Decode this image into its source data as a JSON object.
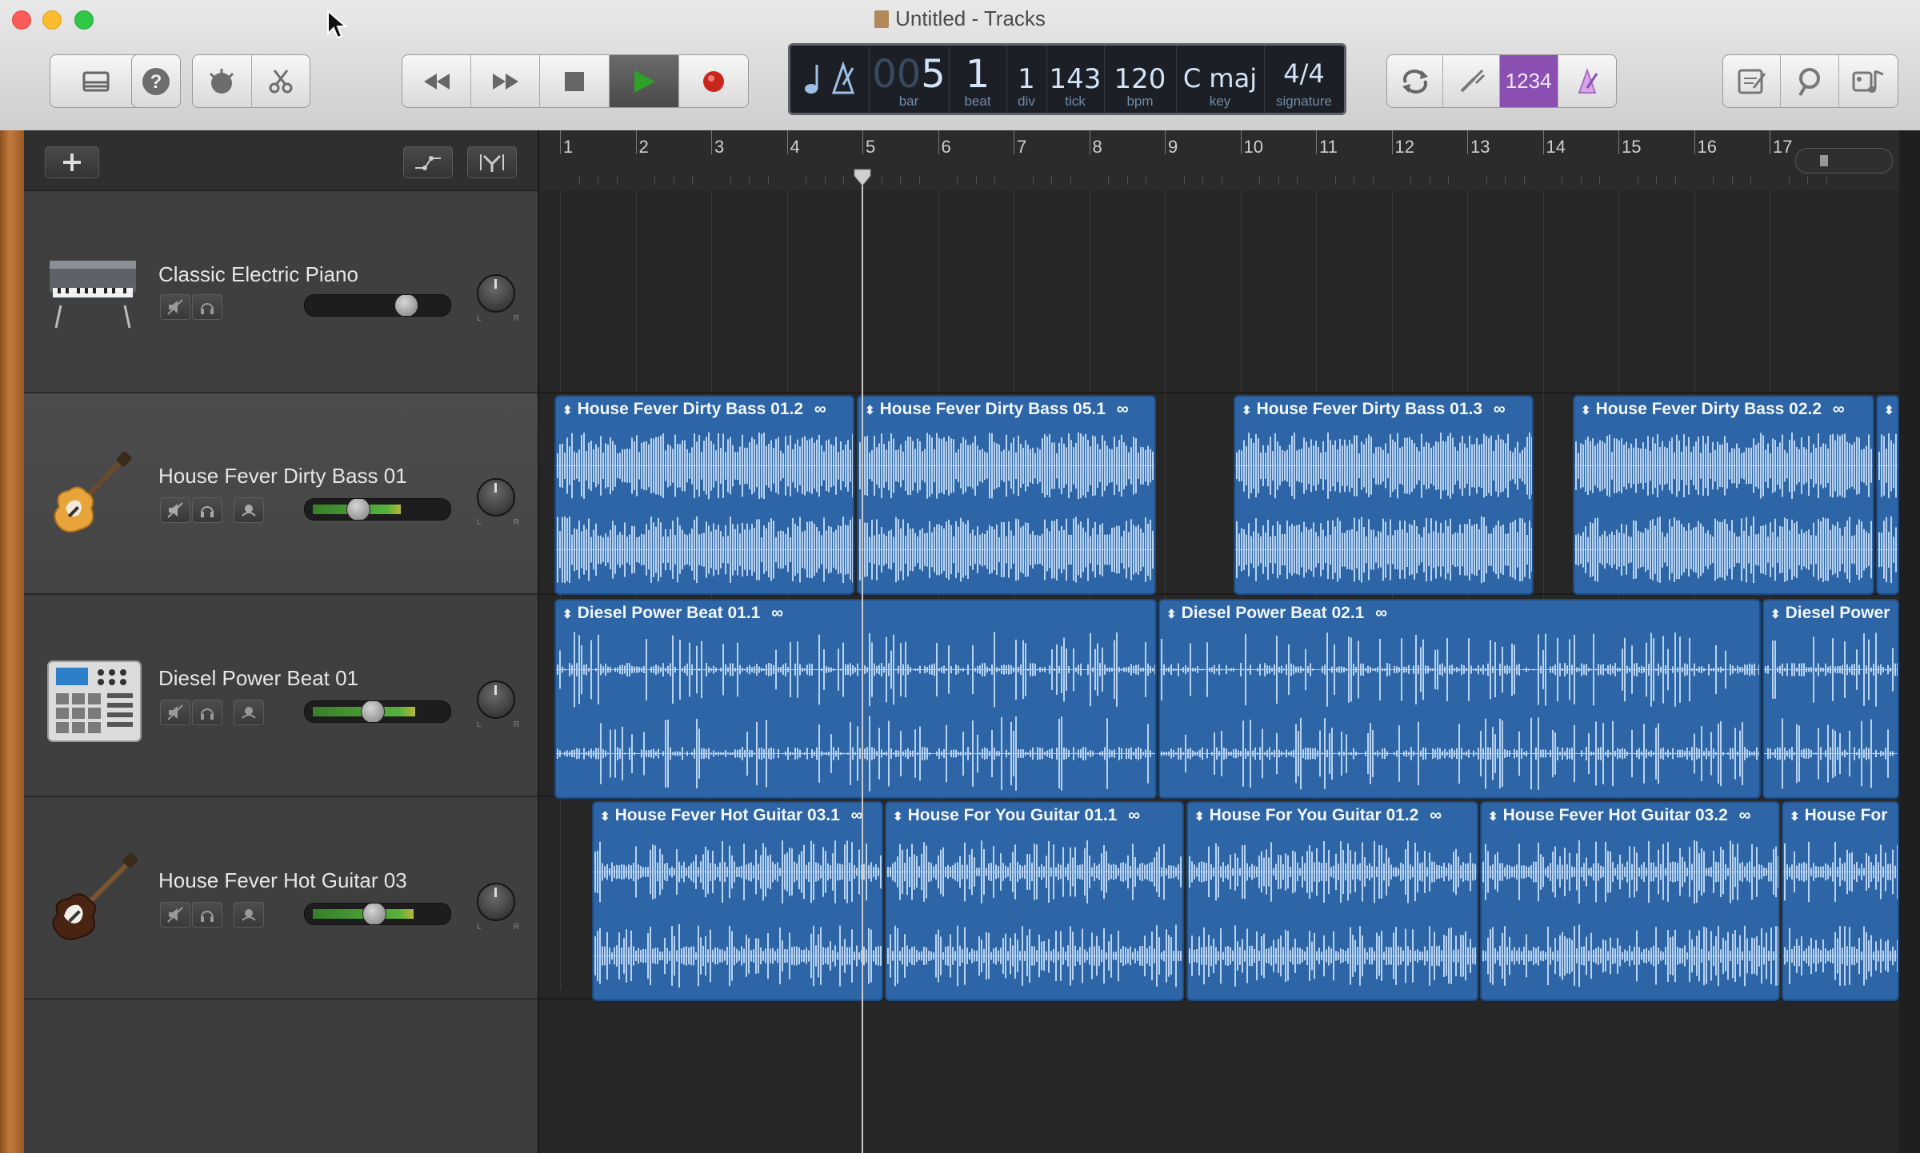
{
  "window": {
    "title": "Untitled - Tracks"
  },
  "lcd": {
    "bar_lead": "00",
    "bar": "5",
    "bar_label": "bar",
    "beat": "1",
    "beat_label": "beat",
    "div": "1",
    "div_label": "div",
    "tick": "143",
    "tick_label": "tick",
    "bpm": "120",
    "bpm_label": "bpm",
    "key": "C maj",
    "key_label": "key",
    "signature": "4/4",
    "signature_label": "signature"
  },
  "toolbar": {
    "count_in": "1234",
    "accent": "#8a4fb0",
    "play_color": "#2fa12b",
    "record_color": "#c8261c"
  },
  "ruler": {
    "bars": [
      "1",
      "2",
      "3",
      "4",
      "5",
      "6",
      "7",
      "8",
      "9",
      "10",
      "11",
      "12",
      "13",
      "14",
      "15",
      "16",
      "17"
    ]
  },
  "tracks": [
    {
      "name": "Classic Electric Piano",
      "icon": "electric-piano-icon",
      "volume": 0.72,
      "selected": false
    },
    {
      "name": "House Fever Dirty Bass 01",
      "icon": "bass-guitar-icon",
      "volume": 0.38,
      "selected": true
    },
    {
      "name": "Diesel Power Beat 01",
      "icon": "drum-machine-icon",
      "volume": 0.48,
      "selected": false
    },
    {
      "name": "House Fever Hot Guitar 03",
      "icon": "electric-guitar-icon",
      "volume": 0.5,
      "selected": false
    }
  ],
  "regions": {
    "bass": [
      {
        "label": "House Fever Dirty Bass 01.2"
      },
      {
        "label": "House Fever Dirty Bass 05.1"
      },
      {
        "label": "House Fever Dirty Bass 01.3"
      },
      {
        "label": "House Fever Dirty Bass 02.2"
      },
      {
        "label": ""
      }
    ],
    "beat": [
      {
        "label": "Diesel Power Beat 01.1"
      },
      {
        "label": "Diesel Power Beat 02.1"
      },
      {
        "label": "Diesel Power"
      }
    ],
    "guitar": [
      {
        "label": "House Fever Hot Guitar 03.1"
      },
      {
        "label": "House For You Guitar 01.1"
      },
      {
        "label": "House For You Guitar 01.2"
      },
      {
        "label": "House Fever Hot Guitar 03.2"
      },
      {
        "label": "House For"
      }
    ]
  },
  "playhead": {
    "bar": 5
  }
}
